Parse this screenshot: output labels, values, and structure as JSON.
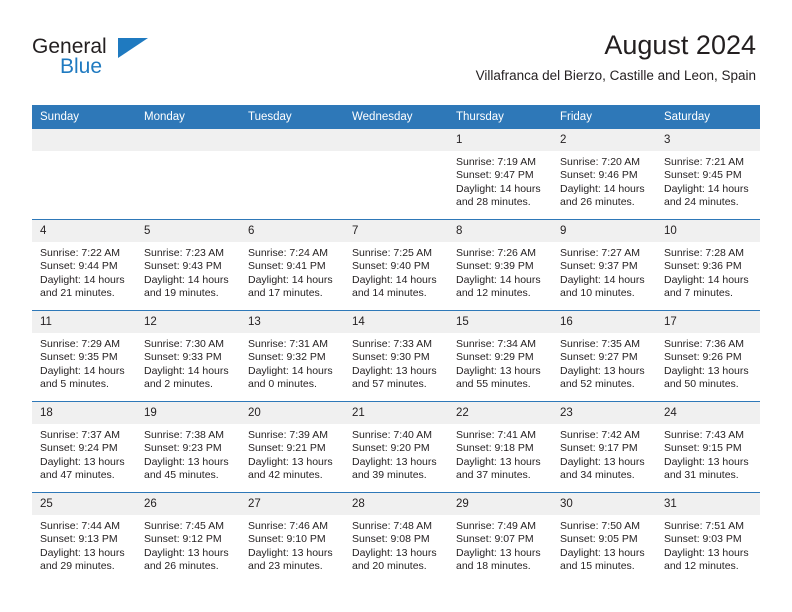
{
  "logo": {
    "word_one": "General",
    "word_two": "Blue",
    "triangle_color": "#1f7ac0"
  },
  "header": {
    "title": "August 2024",
    "subtitle": "Villafranca del Bierzo, Castille and Leon, Spain",
    "accent_color": "#2e78b8"
  },
  "weekday_headers": [
    "Sunday",
    "Monday",
    "Tuesday",
    "Wednesday",
    "Thursday",
    "Friday",
    "Saturday"
  ],
  "weeks": [
    [
      {
        "day": "",
        "empty": true
      },
      {
        "day": "",
        "empty": true
      },
      {
        "day": "",
        "empty": true
      },
      {
        "day": "",
        "empty": true
      },
      {
        "day": "1",
        "sunrise": "Sunrise: 7:19 AM",
        "sunset": "Sunset: 9:47 PM",
        "daylight_1": "Daylight: 14 hours",
        "daylight_2": "and 28 minutes."
      },
      {
        "day": "2",
        "sunrise": "Sunrise: 7:20 AM",
        "sunset": "Sunset: 9:46 PM",
        "daylight_1": "Daylight: 14 hours",
        "daylight_2": "and 26 minutes."
      },
      {
        "day": "3",
        "sunrise": "Sunrise: 7:21 AM",
        "sunset": "Sunset: 9:45 PM",
        "daylight_1": "Daylight: 14 hours",
        "daylight_2": "and 24 minutes."
      }
    ],
    [
      {
        "day": "4",
        "sunrise": "Sunrise: 7:22 AM",
        "sunset": "Sunset: 9:44 PM",
        "daylight_1": "Daylight: 14 hours",
        "daylight_2": "and 21 minutes."
      },
      {
        "day": "5",
        "sunrise": "Sunrise: 7:23 AM",
        "sunset": "Sunset: 9:43 PM",
        "daylight_1": "Daylight: 14 hours",
        "daylight_2": "and 19 minutes."
      },
      {
        "day": "6",
        "sunrise": "Sunrise: 7:24 AM",
        "sunset": "Sunset: 9:41 PM",
        "daylight_1": "Daylight: 14 hours",
        "daylight_2": "and 17 minutes."
      },
      {
        "day": "7",
        "sunrise": "Sunrise: 7:25 AM",
        "sunset": "Sunset: 9:40 PM",
        "daylight_1": "Daylight: 14 hours",
        "daylight_2": "and 14 minutes."
      },
      {
        "day": "8",
        "sunrise": "Sunrise: 7:26 AM",
        "sunset": "Sunset: 9:39 PM",
        "daylight_1": "Daylight: 14 hours",
        "daylight_2": "and 12 minutes."
      },
      {
        "day": "9",
        "sunrise": "Sunrise: 7:27 AM",
        "sunset": "Sunset: 9:37 PM",
        "daylight_1": "Daylight: 14 hours",
        "daylight_2": "and 10 minutes."
      },
      {
        "day": "10",
        "sunrise": "Sunrise: 7:28 AM",
        "sunset": "Sunset: 9:36 PM",
        "daylight_1": "Daylight: 14 hours",
        "daylight_2": "and 7 minutes."
      }
    ],
    [
      {
        "day": "11",
        "sunrise": "Sunrise: 7:29 AM",
        "sunset": "Sunset: 9:35 PM",
        "daylight_1": "Daylight: 14 hours",
        "daylight_2": "and 5 minutes."
      },
      {
        "day": "12",
        "sunrise": "Sunrise: 7:30 AM",
        "sunset": "Sunset: 9:33 PM",
        "daylight_1": "Daylight: 14 hours",
        "daylight_2": "and 2 minutes."
      },
      {
        "day": "13",
        "sunrise": "Sunrise: 7:31 AM",
        "sunset": "Sunset: 9:32 PM",
        "daylight_1": "Daylight: 14 hours",
        "daylight_2": "and 0 minutes."
      },
      {
        "day": "14",
        "sunrise": "Sunrise: 7:33 AM",
        "sunset": "Sunset: 9:30 PM",
        "daylight_1": "Daylight: 13 hours",
        "daylight_2": "and 57 minutes."
      },
      {
        "day": "15",
        "sunrise": "Sunrise: 7:34 AM",
        "sunset": "Sunset: 9:29 PM",
        "daylight_1": "Daylight: 13 hours",
        "daylight_2": "and 55 minutes."
      },
      {
        "day": "16",
        "sunrise": "Sunrise: 7:35 AM",
        "sunset": "Sunset: 9:27 PM",
        "daylight_1": "Daylight: 13 hours",
        "daylight_2": "and 52 minutes."
      },
      {
        "day": "17",
        "sunrise": "Sunrise: 7:36 AM",
        "sunset": "Sunset: 9:26 PM",
        "daylight_1": "Daylight: 13 hours",
        "daylight_2": "and 50 minutes."
      }
    ],
    [
      {
        "day": "18",
        "sunrise": "Sunrise: 7:37 AM",
        "sunset": "Sunset: 9:24 PM",
        "daylight_1": "Daylight: 13 hours",
        "daylight_2": "and 47 minutes."
      },
      {
        "day": "19",
        "sunrise": "Sunrise: 7:38 AM",
        "sunset": "Sunset: 9:23 PM",
        "daylight_1": "Daylight: 13 hours",
        "daylight_2": "and 45 minutes."
      },
      {
        "day": "20",
        "sunrise": "Sunrise: 7:39 AM",
        "sunset": "Sunset: 9:21 PM",
        "daylight_1": "Daylight: 13 hours",
        "daylight_2": "and 42 minutes."
      },
      {
        "day": "21",
        "sunrise": "Sunrise: 7:40 AM",
        "sunset": "Sunset: 9:20 PM",
        "daylight_1": "Daylight: 13 hours",
        "daylight_2": "and 39 minutes."
      },
      {
        "day": "22",
        "sunrise": "Sunrise: 7:41 AM",
        "sunset": "Sunset: 9:18 PM",
        "daylight_1": "Daylight: 13 hours",
        "daylight_2": "and 37 minutes."
      },
      {
        "day": "23",
        "sunrise": "Sunrise: 7:42 AM",
        "sunset": "Sunset: 9:17 PM",
        "daylight_1": "Daylight: 13 hours",
        "daylight_2": "and 34 minutes."
      },
      {
        "day": "24",
        "sunrise": "Sunrise: 7:43 AM",
        "sunset": "Sunset: 9:15 PM",
        "daylight_1": "Daylight: 13 hours",
        "daylight_2": "and 31 minutes."
      }
    ],
    [
      {
        "day": "25",
        "sunrise": "Sunrise: 7:44 AM",
        "sunset": "Sunset: 9:13 PM",
        "daylight_1": "Daylight: 13 hours",
        "daylight_2": "and 29 minutes."
      },
      {
        "day": "26",
        "sunrise": "Sunrise: 7:45 AM",
        "sunset": "Sunset: 9:12 PM",
        "daylight_1": "Daylight: 13 hours",
        "daylight_2": "and 26 minutes."
      },
      {
        "day": "27",
        "sunrise": "Sunrise: 7:46 AM",
        "sunset": "Sunset: 9:10 PM",
        "daylight_1": "Daylight: 13 hours",
        "daylight_2": "and 23 minutes."
      },
      {
        "day": "28",
        "sunrise": "Sunrise: 7:48 AM",
        "sunset": "Sunset: 9:08 PM",
        "daylight_1": "Daylight: 13 hours",
        "daylight_2": "and 20 minutes."
      },
      {
        "day": "29",
        "sunrise": "Sunrise: 7:49 AM",
        "sunset": "Sunset: 9:07 PM",
        "daylight_1": "Daylight: 13 hours",
        "daylight_2": "and 18 minutes."
      },
      {
        "day": "30",
        "sunrise": "Sunrise: 7:50 AM",
        "sunset": "Sunset: 9:05 PM",
        "daylight_1": "Daylight: 13 hours",
        "daylight_2": "and 15 minutes."
      },
      {
        "day": "31",
        "sunrise": "Sunrise: 7:51 AM",
        "sunset": "Sunset: 9:03 PM",
        "daylight_1": "Daylight: 13 hours",
        "daylight_2": "and 12 minutes."
      }
    ]
  ]
}
